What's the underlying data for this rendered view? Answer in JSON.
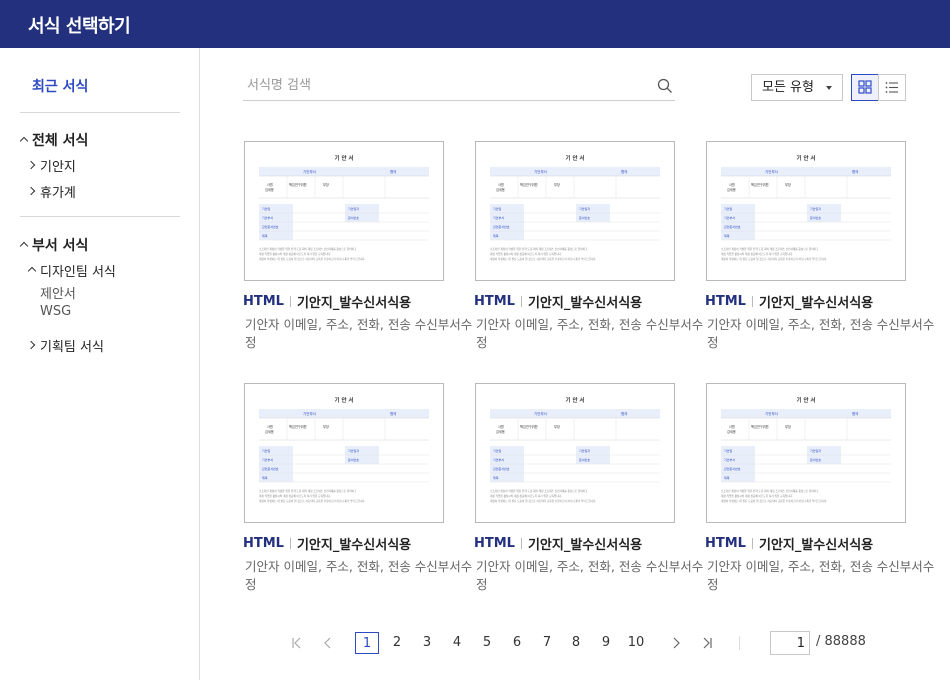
{
  "app": {
    "title": "서식 선택하기"
  },
  "sidebar": {
    "recent_label": "최근 서식",
    "groups": [
      {
        "label": "전체 서식",
        "children": [
          {
            "label": "기안지"
          },
          {
            "label": "휴가계"
          }
        ]
      },
      {
        "label": "부서 서식",
        "children": [
          {
            "label": "디자인팀 서식",
            "children": [
              {
                "label": "제안서"
              },
              {
                "label": "WSG"
              }
            ]
          },
          {
            "label": "기획팀 서식"
          }
        ]
      }
    ]
  },
  "search": {
    "placeholder": "서식명 검색",
    "value": ""
  },
  "filter": {
    "selected": "모든 유형"
  },
  "view": {
    "mode": "grid",
    "icons": [
      "grid-view-icon",
      "list-view-icon"
    ]
  },
  "thumbnail": {
    "title": "기 안 서",
    "head1": "기안부서",
    "head2": "협의",
    "r1": "사원",
    "r1b": "김세용",
    "r2": "책임연구위원",
    "r3": "부장",
    "f1": "기안일",
    "f2": "기안부서",
    "f3": "관련문서번호",
    "f4": "제목",
    "f5": "기안일자",
    "f6": "문서번호",
    "body1": "오프라인 계정이 작성을 위한 전략 도출 회의 계정 프로세스 신인사제를 중심으로 준비하고",
    "body2": "계정 작업을 활성시켜 계정 성공에 이르도록 하기 위한 교육입니다.",
    "body3": "계정이 작성하는 데 필요 도움이 될 것으로 사료되며 교육을 수강하고자 하오니 재가 부탁드립니다."
  },
  "cards": [
    {
      "format": "HTML",
      "name": "기안지_발수신서식용",
      "desc": "기안자 이메일, 주소, 전화, 전송 수신부서수정"
    },
    {
      "format": "HTML",
      "name": "기안지_발수신서식용",
      "desc": "기안자 이메일, 주소, 전화, 전송 수신부서수정"
    },
    {
      "format": "HTML",
      "name": "기안지_발수신서식용",
      "desc": "기안자 이메일, 주소, 전화, 전송 수신부서수정"
    },
    {
      "format": "HTML",
      "name": "기안지_발수신서식용",
      "desc": "기안자 이메일, 주소, 전화, 전송 수신부서수정"
    },
    {
      "format": "HTML",
      "name": "기안지_발수신서식용",
      "desc": "기안자 이메일, 주소, 전화, 전송 수신부서수정"
    },
    {
      "format": "HTML",
      "name": "기안지_발수신서식용",
      "desc": "기안자 이메일, 주소, 전화, 전송 수신부서수정"
    }
  ],
  "pagination": {
    "pages": [
      "1",
      "2",
      "3",
      "4",
      "5",
      "6",
      "7",
      "8",
      "9",
      "10"
    ],
    "current": "1",
    "input_value": "1",
    "total": "/ 88888",
    "icons": [
      "first-page-icon",
      "prev-page-icon",
      "next-page-icon",
      "last-page-icon"
    ]
  },
  "colors": {
    "header": "#22307e",
    "accent": "#2f4bc4",
    "format": "#22307e"
  }
}
